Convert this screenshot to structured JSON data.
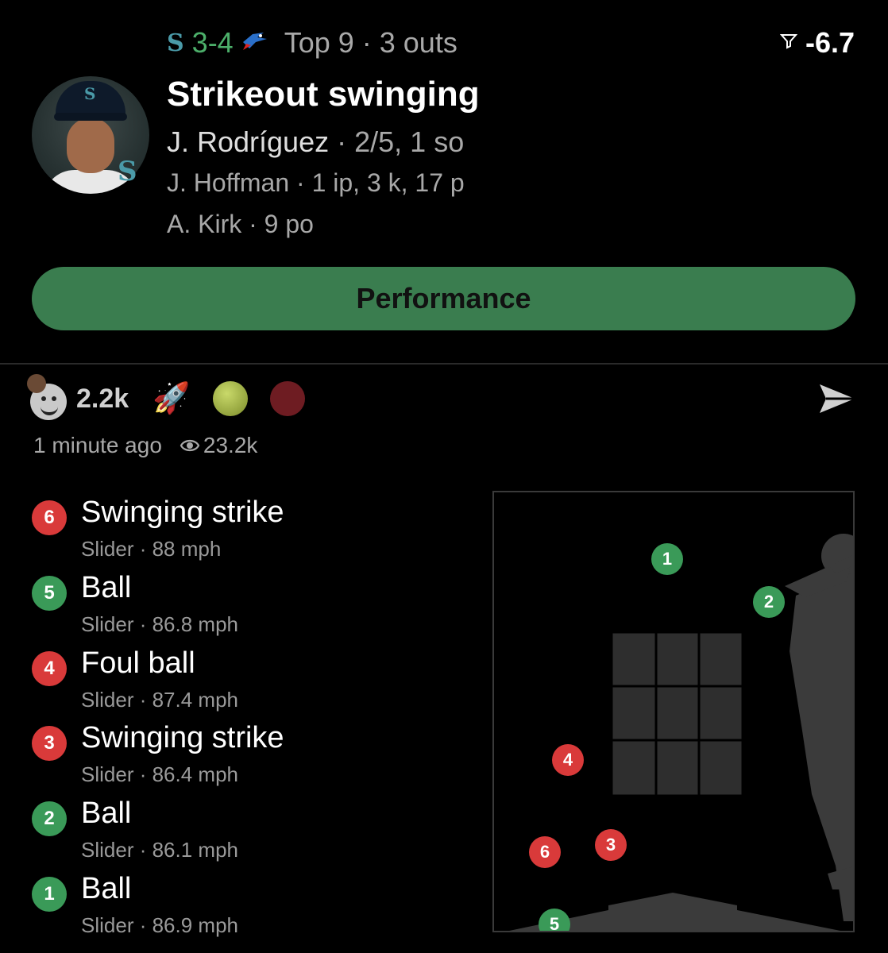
{
  "colors": {
    "ball": "#3a9a58",
    "strike": "#d93a3a",
    "accent_green": "#3a7d4f"
  },
  "game": {
    "away_team_icon": "S",
    "score": "3-4",
    "home_team_icon": "blue-jays-bird-icon",
    "inning_info": "Top 9 · 3 outs",
    "win_prob_icon": "filter-funnel-icon",
    "win_prob_change": "-6.7"
  },
  "play": {
    "headline": "Strikeout swinging",
    "batter_name": "J. Rodríguez",
    "batter_stats": "· 2/5, 1 so",
    "pitcher": "J. Hoffman · 1 ip, 3 k, 17 p",
    "fielder": "A. Kirk · 9 po",
    "team_badge": "S"
  },
  "performance_button": "Performance",
  "reactions": {
    "count": "2.2k"
  },
  "meta": {
    "time": "1 minute ago",
    "views": "23.2k"
  },
  "pitches": [
    {
      "num": "6",
      "result": "Swinging strike",
      "type": "Slider",
      "speed": "88 mph",
      "kind": "strike"
    },
    {
      "num": "5",
      "result": "Ball",
      "type": "Slider",
      "speed": "86.8 mph",
      "kind": "ball"
    },
    {
      "num": "4",
      "result": "Foul ball",
      "type": "Slider",
      "speed": "87.4 mph",
      "kind": "strike"
    },
    {
      "num": "3",
      "result": "Swinging strike",
      "type": "Slider",
      "speed": "86.4 mph",
      "kind": "strike"
    },
    {
      "num": "2",
      "result": "Ball",
      "type": "Slider",
      "speed": "86.1 mph",
      "kind": "ball"
    },
    {
      "num": "1",
      "result": "Ball",
      "type": "Slider",
      "speed": "86.9 mph",
      "kind": "ball"
    }
  ]
}
